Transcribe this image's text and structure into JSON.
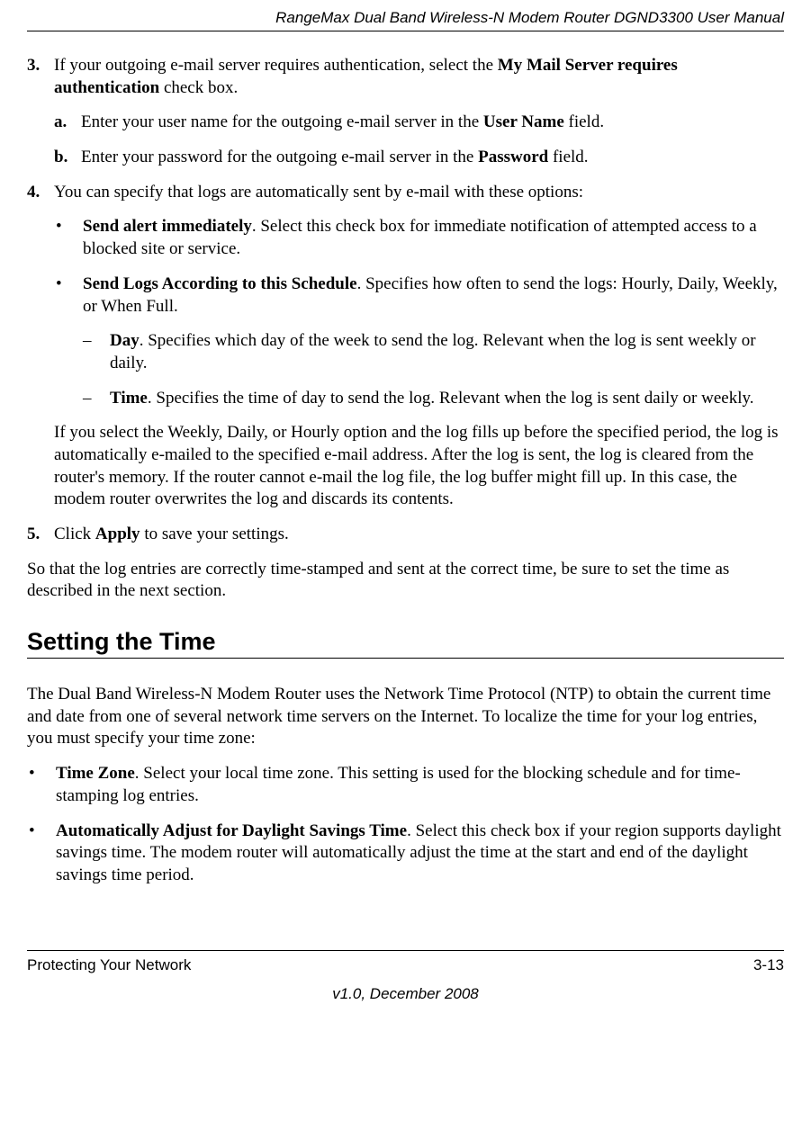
{
  "header": {
    "title": "RangeMax Dual Band Wireless-N Modem Router DGND3300 User Manual"
  },
  "step3": {
    "num": "3.",
    "text_part1": "If your outgoing e-mail server requires authentication, select the ",
    "bold1": "My Mail Server requires authentication",
    "text_part2": " check box."
  },
  "step3a": {
    "num": "a.",
    "text_part1": "Enter your user name for the outgoing e-mail server in the ",
    "bold1": "User Name",
    "text_part2": " field."
  },
  "step3b": {
    "num": "b.",
    "text_part1": "Enter your password for the outgoing e-mail server in the ",
    "bold1": "Password",
    "text_part2": " field."
  },
  "step4": {
    "num": "4.",
    "text": "You can specify that logs are automatically sent by e-mail with these options:"
  },
  "b1": {
    "sym": "•",
    "bold": "Send alert immediately",
    "text": ". Select this check box for immediate notification of attempted access to a blocked site or service."
  },
  "b2": {
    "sym": "•",
    "bold": "Send Logs According to this Schedule",
    "text": ". Specifies how often to send the logs: Hourly, Daily, Weekly, or When Full."
  },
  "d1": {
    "sym": "–",
    "bold": "Day",
    "text": ". Specifies which day of the week to send the log. Relevant when the log is sent weekly or daily."
  },
  "d2": {
    "sym": "–",
    "bold": "Time",
    "text": ". Specifies the time of day to send the log. Relevant when the log is sent daily or weekly."
  },
  "follow": {
    "text": "If you select the Weekly, Daily, or Hourly option and the log fills up before the specified period, the log is automatically e-mailed to the specified e-mail address. After the log is sent, the log is cleared from the router's memory. If the router cannot e-mail the log file, the log buffer might fill up. In this case, the modem router overwrites the log and discards its contents."
  },
  "step5": {
    "num": "5.",
    "text_part1": "Click ",
    "bold1": "Apply",
    "text_part2": " to save your settings."
  },
  "closing": {
    "text": "So that the log entries are correctly time-stamped and sent at the correct time, be sure to set the time as described in the next section."
  },
  "heading": "Setting the Time",
  "section_p": {
    "text": "The Dual Band Wireless-N Modem Router uses the Network Time Protocol (NTP) to obtain the current time and date from one of several network time servers on the Internet. To localize the time for your log entries, you must specify your time zone:"
  },
  "sb1": {
    "sym": "•",
    "bold": "Time Zone",
    "text": ". Select your local time zone. This setting is used for the blocking schedule and for time-stamping log entries."
  },
  "sb2": {
    "sym": "•",
    "bold": "Automatically Adjust for Daylight Savings Time",
    "text": ". Select this check box if your region supports daylight savings time. The modem router will automatically adjust the time at the start and end of the daylight savings time period."
  },
  "footer": {
    "left": "Protecting Your Network",
    "right": "3-13",
    "version": "v1.0, December 2008"
  }
}
